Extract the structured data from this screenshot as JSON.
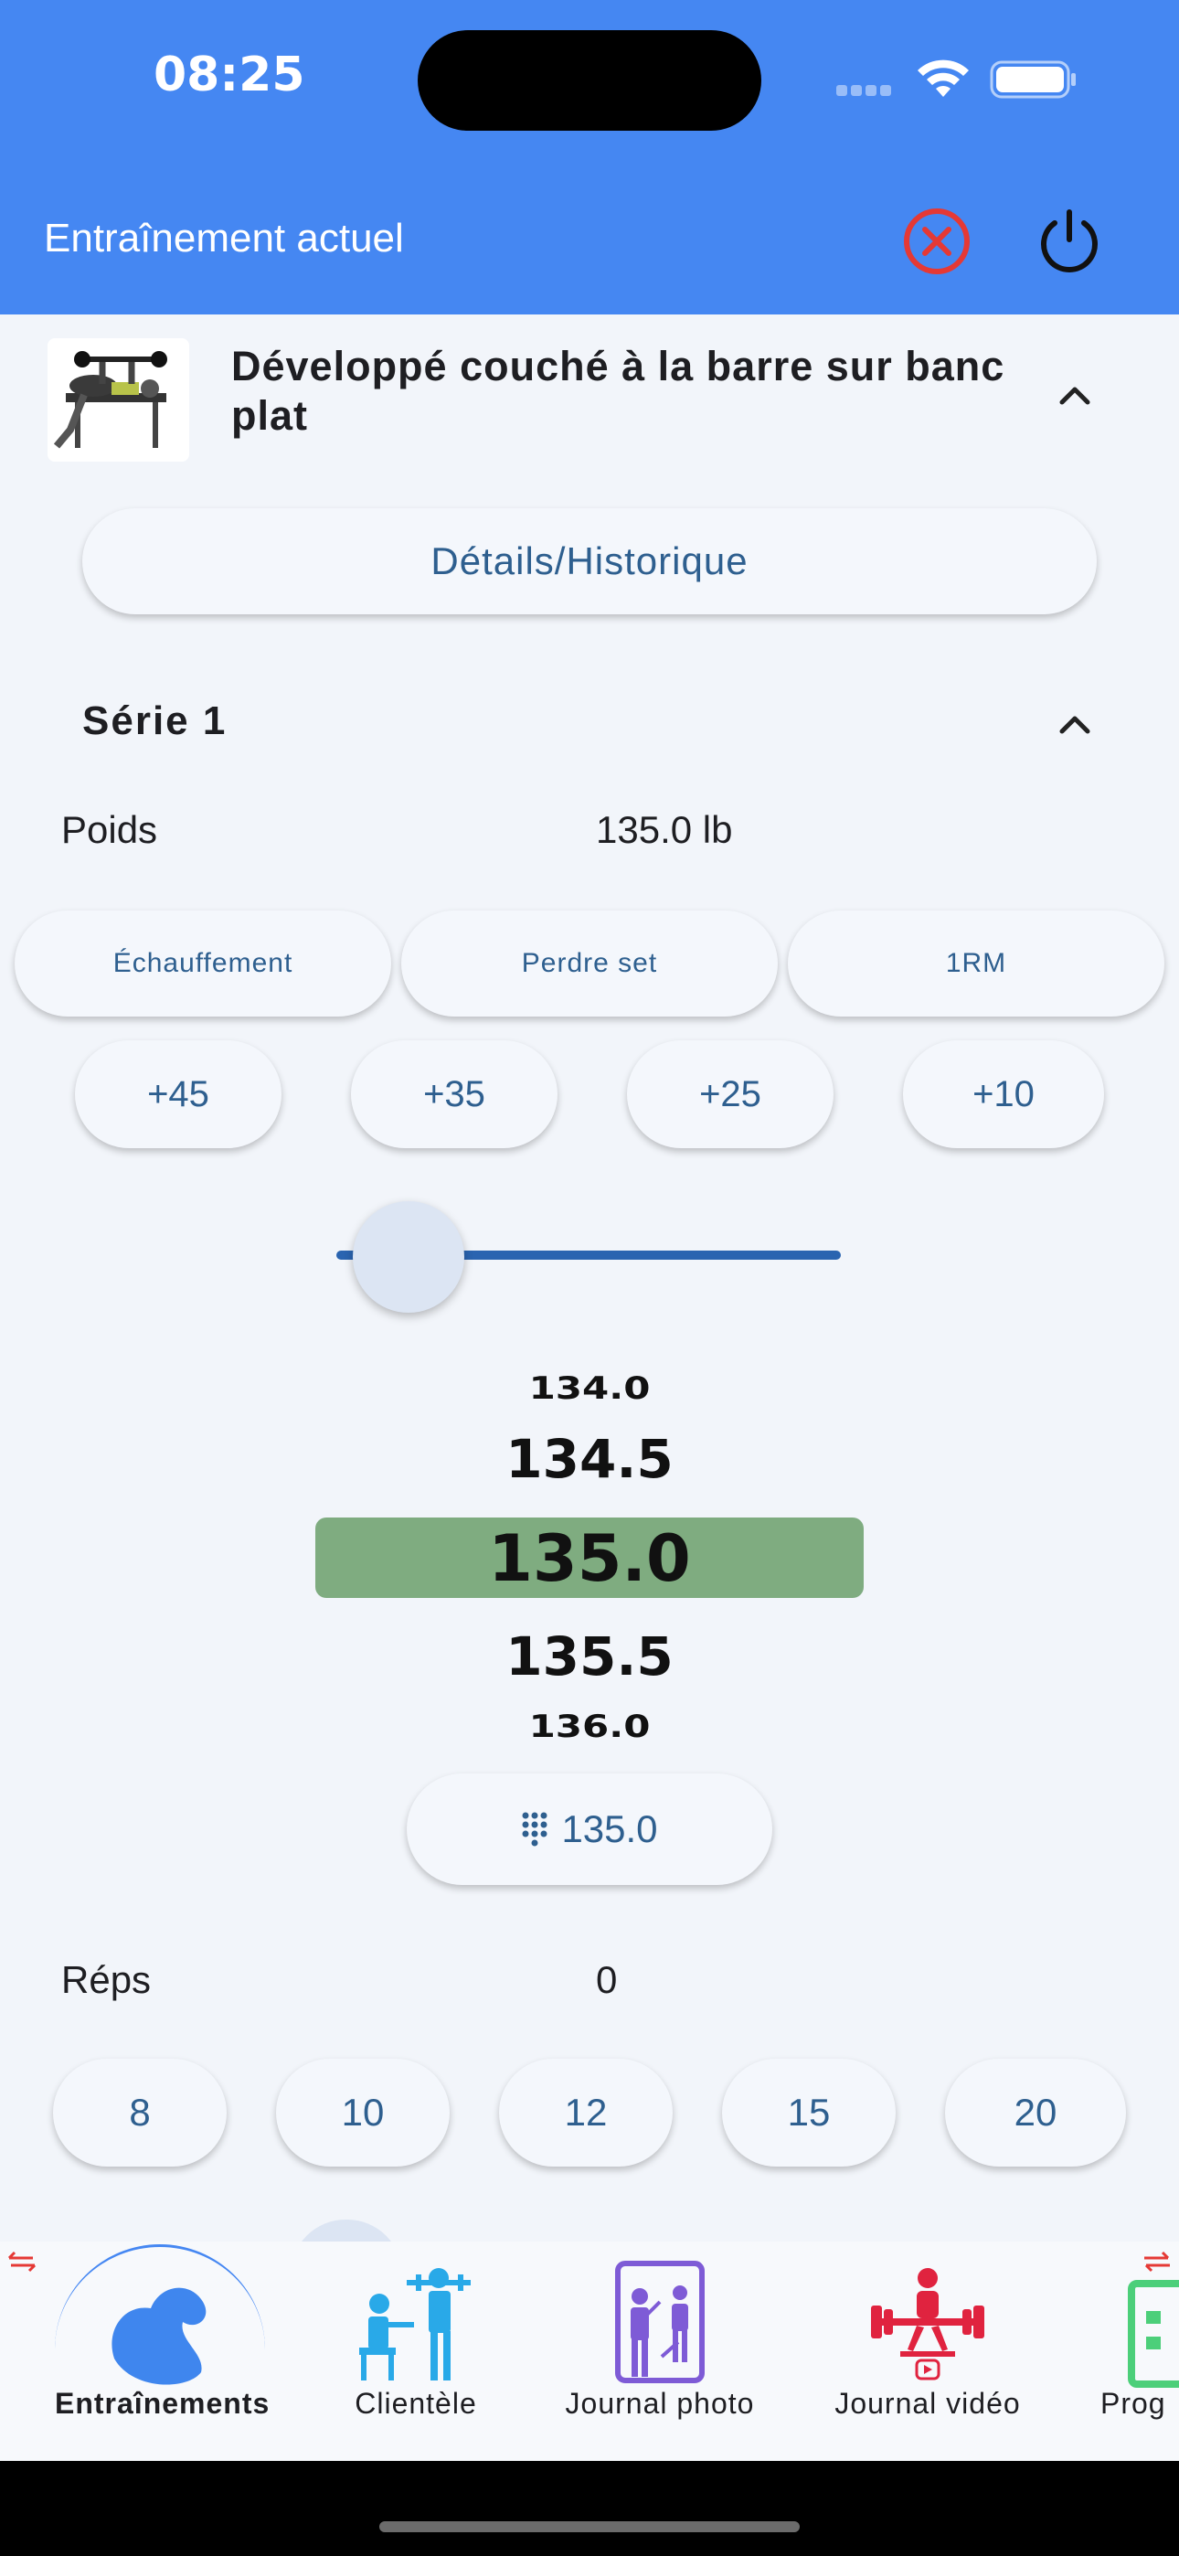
{
  "status_bar": {
    "time": "08:25"
  },
  "header": {
    "title": "Entraînement actuel"
  },
  "exercise": {
    "title": "Développé couché à la barre sur banc plat",
    "details_button": "Détails/Historique"
  },
  "serie": {
    "label": "Série 1",
    "weight_label": "Poids",
    "weight_value": "135.0 lb",
    "type_buttons": [
      "Échauffement",
      "Perdre set",
      "1RM"
    ],
    "increment_buttons": [
      "+45",
      "+35",
      "+25",
      "+10"
    ],
    "slider_value_fraction": 0.05,
    "picker": [
      "134.0",
      "134.5",
      "135.0",
      "135.5",
      "136.0"
    ],
    "keypad_value": "135.0",
    "reps_label": "Réps",
    "reps_value": "0",
    "reps_buttons": [
      "8",
      "10",
      "12",
      "15",
      "20"
    ]
  },
  "bottom_nav": {
    "items": [
      {
        "label": "Entraînements",
        "icon": "muscle-arm-icon",
        "active": true
      },
      {
        "label": "Clientèle",
        "icon": "trainer-client-icon",
        "active": false
      },
      {
        "label": "Journal photo",
        "icon": "mirror-selfie-icon",
        "active": false
      },
      {
        "label": "Journal vidéo",
        "icon": "weightlifter-video-icon",
        "active": false
      },
      {
        "label": "Prog",
        "icon": "program-icon",
        "active": false
      }
    ]
  },
  "colors": {
    "header_bg": "#4587f2",
    "accent_text": "#2e5f8f",
    "picker_selected": "#7fac80",
    "close_red": "#e53935"
  }
}
